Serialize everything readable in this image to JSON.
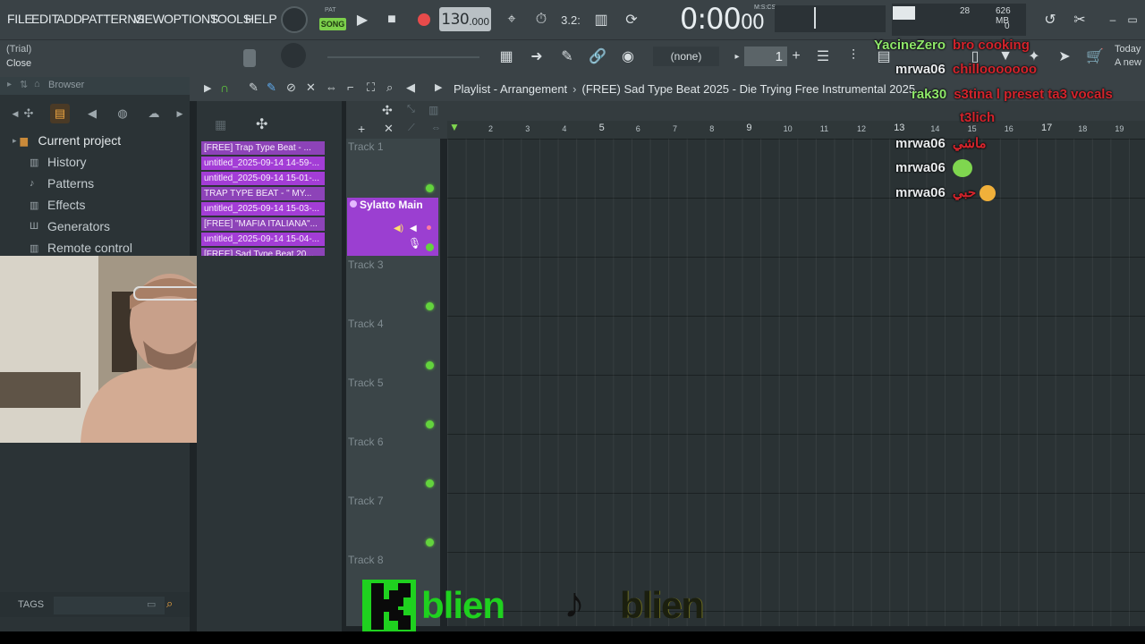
{
  "menu": [
    "FILE",
    "EDIT",
    "ADD",
    "PATTERNS",
    "VIEW",
    "OPTIONS",
    "TOOLS",
    "HELP"
  ],
  "transport": {
    "pat_label": "PAT",
    "song_label": "SONG",
    "bpm": "130",
    "bpm_decimal": ".000",
    "time": "0:00",
    "time_cs": "00",
    "time_unit": "M:S:CS",
    "beat_display": "3.2:"
  },
  "cpu": {
    "voices": "28",
    "memory": "626 MB",
    "extra": "0"
  },
  "hint": {
    "line1": "(Trial)",
    "line2": "Close"
  },
  "pattern": {
    "selector": "(none)",
    "number": "1"
  },
  "recent": {
    "line1": "Today",
    "line2": "A new"
  },
  "browser": {
    "title": "Browser",
    "items": [
      "Current project",
      "History",
      "Patterns",
      "Effects",
      "Generators",
      "Remote control"
    ],
    "tags_label": "TAGS"
  },
  "clips": [
    "[FREE] Trap Type Beat - ...",
    "untitled_2025-09-14 14-59-...",
    "untitled_2025-09-14 15-01-...",
    "TRAP TYPE BEAT - \" MY...",
    "untitled_2025-09-14 15-03-...",
    "[FREE] \"MAFIA ITALIANA\"...",
    "untitled_2025-09-14 15-04-...",
    "[FREE] Sad Type Beat 20..."
  ],
  "playlist": {
    "title": "Playlist - Arrangement",
    "arrangement": "(FREE) Sad Type Beat 2025 - Die Trying  Free Instrumental 2025",
    "main_track": "Sylatto Main",
    "tracks": [
      "Track 1",
      "Track 3",
      "Track 4",
      "Track 5",
      "Track 6",
      "Track 7",
      "Track 8"
    ],
    "ruler": [
      "2",
      "3",
      "4",
      "5",
      "6",
      "7",
      "8",
      "9",
      "10",
      "11",
      "12",
      "13",
      "14",
      "15",
      "16",
      "17",
      "18",
      "19"
    ]
  },
  "chat": [
    {
      "user": "YacineZero",
      "msg": "bro cooking",
      "user_color": "green"
    },
    {
      "user": "mrwa06",
      "msg": "chillooooooo",
      "user_color": "white"
    },
    {
      "user": "rak30",
      "msg": "s3tina l preset ta3 vocals",
      "user_color": "green"
    },
    {
      "user": "",
      "msg": "t3lich",
      "user_color": "white"
    },
    {
      "user": "mrwa06",
      "msg": "ماشي",
      "user_color": "white"
    },
    {
      "user": "mrwa06",
      "msg": "",
      "user_color": "white"
    },
    {
      "user": "mrwa06",
      "msg": "حبي",
      "user_color": "white"
    }
  ],
  "overlay_logo": "blien",
  "colors": {
    "accent_green": "#63d33d",
    "clip_purple": "#a33dd6",
    "chat_red": "#d3242c"
  }
}
